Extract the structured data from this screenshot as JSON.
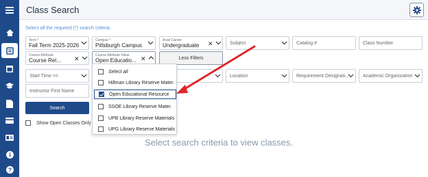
{
  "header": {
    "title": "Class Search"
  },
  "instructions": "Select all the required (*) search criteria.",
  "fields": {
    "term": {
      "label": "Term *",
      "value": "Fall Term 2025-2026"
    },
    "campus": {
      "label": "Campus *",
      "value": "Pittsburgh Campus"
    },
    "career": {
      "label": "Acad Career",
      "value": "Undergraduate"
    },
    "subject": {
      "placeholder": "Subject"
    },
    "catalog": {
      "placeholder": "Catalog #"
    },
    "class_number": {
      "placeholder": "Class Number"
    },
    "course_attribute": {
      "label": "Course Attribute",
      "value": "Course Rel..."
    },
    "course_attribute_value": {
      "label": "Course Attribute Value",
      "value": "Open Educatio..."
    },
    "start_time": {
      "placeholder": "Start Time >="
    },
    "location": {
      "placeholder": "Location"
    },
    "requirement": {
      "placeholder": "Requirement Designati..."
    },
    "academic_org": {
      "placeholder": "Academic Organization"
    },
    "instructor": {
      "placeholder": "Instructor First Name"
    }
  },
  "buttons": {
    "less_filters": "Less Filters",
    "search": "Search"
  },
  "show_open_label": "Show Open Classes Only",
  "dropdown": {
    "options": [
      {
        "label": "Select all",
        "checked": false
      },
      {
        "label": "Hillman Library Reserve Mater.",
        "checked": false
      },
      {
        "label": "Open Educational Resource",
        "checked": true
      },
      {
        "label": "SSOE Library Reserve Mater.",
        "checked": false
      },
      {
        "label": "UPB Library Reserve Materials",
        "checked": false
      },
      {
        "label": "UPG Library Reserve Materials",
        "checked": false
      }
    ]
  },
  "empty_message": "Select search criteria to view classes.",
  "colors": {
    "sidebar": "#1f4a8a",
    "accent": "#1f4a8a",
    "arrow": "#e0262b"
  },
  "sidebar_icons": [
    "menu-icon",
    "home-icon",
    "search-icon",
    "calendar-icon",
    "graduation-cap-icon",
    "document-icon",
    "card-icon",
    "id-card-icon",
    "info-icon",
    "question-icon"
  ]
}
